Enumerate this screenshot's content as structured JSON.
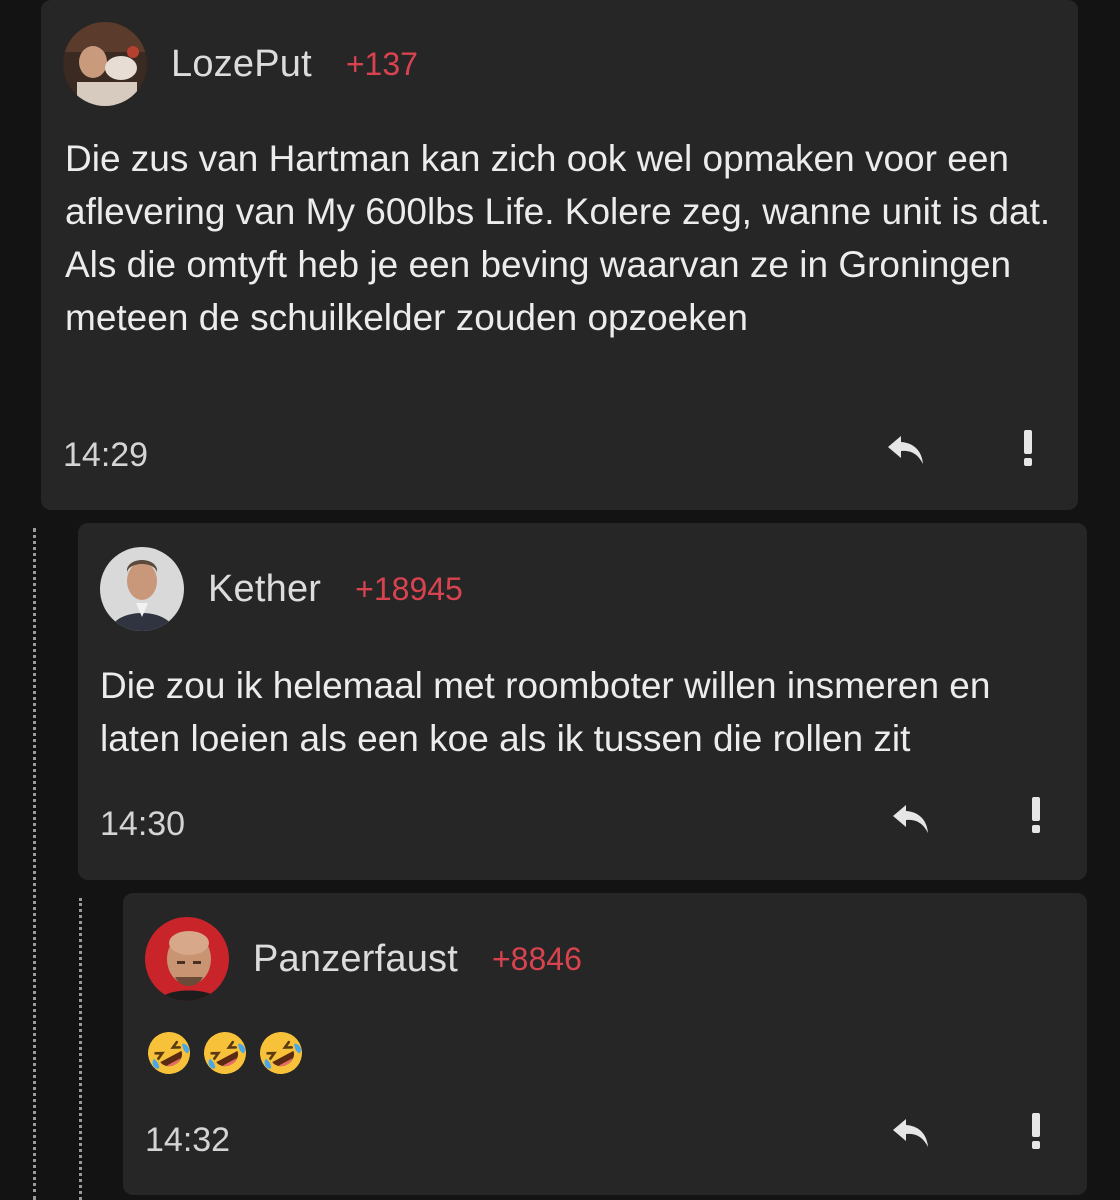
{
  "comments": [
    {
      "username": "LozePut",
      "score": "+137",
      "text": "Die zus van Hartman kan zich ook wel opmaken voor een aflevering van My 600lbs Life. Kolere zeg, wanne unit is dat. Als die omtyft heb je een beving waarvan ze in Groningen meteen de schuilkelder zouden opzoeken",
      "time": "14:29"
    },
    {
      "username": "Kether",
      "score": "+18945",
      "text": "Die zou ik helemaal met roomboter willen insmeren en laten loeien als een koe als ik tussen die rollen zit",
      "time": "14:30"
    },
    {
      "username": "Panzerfaust",
      "score": "+8846",
      "emojis": [
        "rolling-on-floor-laughing",
        "rolling-on-floor-laughing",
        "rolling-on-floor-laughing"
      ],
      "time": "14:32"
    }
  ],
  "colors": {
    "background": "#131313",
    "card": "#262626",
    "score": "#d8434f",
    "text": "#ececec"
  },
  "icons": {
    "reply": "reply-arrow-icon",
    "report": "exclamation-icon"
  }
}
